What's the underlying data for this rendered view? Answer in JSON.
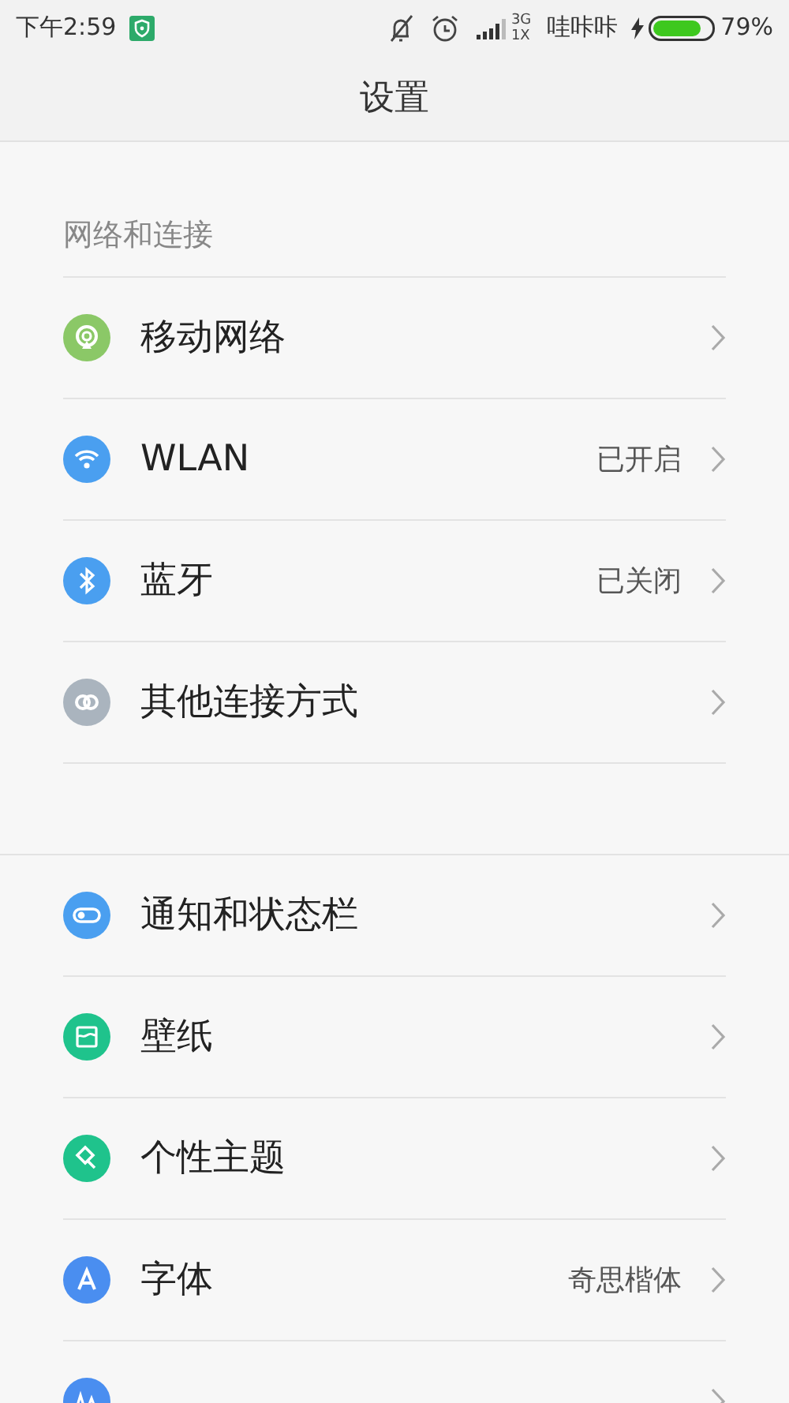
{
  "status_bar": {
    "time": "下午2:59",
    "network_top": "3G",
    "network_bottom": "1X",
    "carrier": "哇咔咔",
    "battery": {
      "level": 0.79,
      "charging": true
    },
    "battery_text": "79%"
  },
  "title": "设置",
  "sections": [
    {
      "header": "网络和连接",
      "items": [
        {
          "label": "移动网络",
          "color": "#8bc867"
        },
        {
          "label": "WLAN",
          "value": "已开启",
          "color": "#4a9ff0"
        },
        {
          "label": "蓝牙",
          "value": "已关闭",
          "color": "#4a9ff0"
        },
        {
          "label": "其他连接方式",
          "color": "#aab4be"
        }
      ]
    },
    {
      "items": [
        {
          "label": "通知和状态栏",
          "color": "#4a9ff0"
        },
        {
          "label": "壁纸",
          "color": "#1fc38c"
        },
        {
          "label": "个性主题",
          "color": "#1fc38c"
        },
        {
          "label": "字体",
          "value": "奇思楷体",
          "color": "#4a8ef0"
        },
        {
          "color": "#4a8ef0"
        }
      ]
    }
  ]
}
